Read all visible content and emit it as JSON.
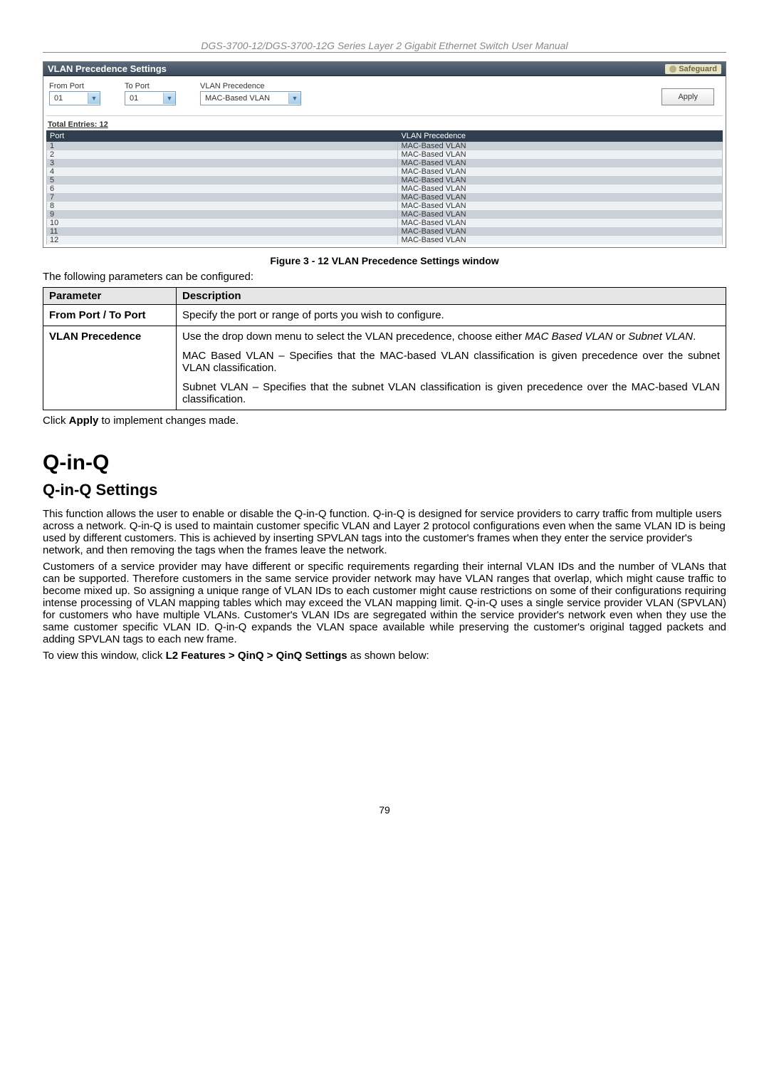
{
  "header": {
    "title": "DGS-3700-12/DGS-3700-12G Series Layer 2 Gigabit Ethernet Switch User Manual"
  },
  "screenshot": {
    "title": "VLAN Precedence Settings",
    "safeguard": "Safeguard",
    "form": {
      "from_port_label": "From Port",
      "from_port_value": "01",
      "to_port_label": "To Port",
      "to_port_value": "01",
      "vlan_precedence_label": "VLAN Precedence",
      "vlan_precedence_value": "MAC-Based VLAN",
      "apply_label": "Apply"
    },
    "total_entries_label": "Total Entries: 12",
    "table": {
      "col_port": "Port",
      "col_vlan": "VLAN Precedence",
      "rows": [
        {
          "port": "1",
          "vlan": "MAC-Based VLAN"
        },
        {
          "port": "2",
          "vlan": "MAC-Based VLAN"
        },
        {
          "port": "3",
          "vlan": "MAC-Based VLAN"
        },
        {
          "port": "4",
          "vlan": "MAC-Based VLAN"
        },
        {
          "port": "5",
          "vlan": "MAC-Based VLAN"
        },
        {
          "port": "6",
          "vlan": "MAC-Based VLAN"
        },
        {
          "port": "7",
          "vlan": "MAC-Based VLAN"
        },
        {
          "port": "8",
          "vlan": "MAC-Based VLAN"
        },
        {
          "port": "9",
          "vlan": "MAC-Based VLAN"
        },
        {
          "port": "10",
          "vlan": "MAC-Based VLAN"
        },
        {
          "port": "11",
          "vlan": "MAC-Based VLAN"
        },
        {
          "port": "12",
          "vlan": "MAC-Based VLAN"
        }
      ]
    }
  },
  "figure_caption": "Figure 3 - 12 VLAN Precedence Settings window",
  "intro_text": "The following parameters can be configured:",
  "param_table": {
    "header_param": "Parameter",
    "header_desc": "Description",
    "rows": [
      {
        "name": "From Port / To Port",
        "desc_plain": "Specify the port or range of ports you wish to configure."
      },
      {
        "name": "VLAN Precedence",
        "desc_p1_a": "Use the drop down menu to select the VLAN precedence, choose either ",
        "desc_p1_i1": "MAC Based VLAN",
        "desc_p1_b": " or ",
        "desc_p1_i2": "Subnet VLAN",
        "desc_p1_c": ".",
        "desc_p2": "MAC Based VLAN – Specifies that the MAC-based VLAN classification is given precedence over the subnet VLAN classification.",
        "desc_p3": "Subnet VLAN – Specifies that the subnet VLAN classification is given precedence over the MAC-based VLAN classification."
      }
    ]
  },
  "apply_note_a": "Click ",
  "apply_note_b": "Apply",
  "apply_note_c": " to implement changes made.",
  "section_title": "Q-in-Q",
  "subsection_title": "Q-in-Q Settings",
  "para1": "This function allows the user to enable or disable the Q-in-Q function. Q-in-Q is designed for service providers to carry traffic from multiple users across a network. Q-in-Q is used to maintain customer specific VLAN and Layer 2 protocol configurations even when the same VLAN ID is being used by different customers. This is achieved by inserting SPVLAN tags into the customer's frames when they enter the service provider's network, and then removing the tags when the frames leave the network.",
  "para2": "Customers of a service provider may have different or specific requirements regarding their internal VLAN IDs and the number of VLANs that can be supported. Therefore customers in the same service provider network may have VLAN ranges that overlap, which might cause traffic to become mixed up. So assigning a unique range of VLAN IDs to each customer might cause restrictions on some of their configurations requiring intense processing of VLAN mapping tables which may exceed the VLAN mapping limit. Q-in-Q uses a single service provider VLAN (SPVLAN) for customers who have multiple VLANs. Customer's VLAN IDs are segregated within the service provider's network even when they use the same customer specific VLAN ID. Q-in-Q expands the VLAN space available while preserving the customer's original tagged packets and adding SPVLAN tags to each new frame.",
  "para3_a": "To view this window, click ",
  "para3_b": "L2 Features > QinQ > QinQ Settings",
  "para3_c": " as shown below:",
  "page_number": "79"
}
